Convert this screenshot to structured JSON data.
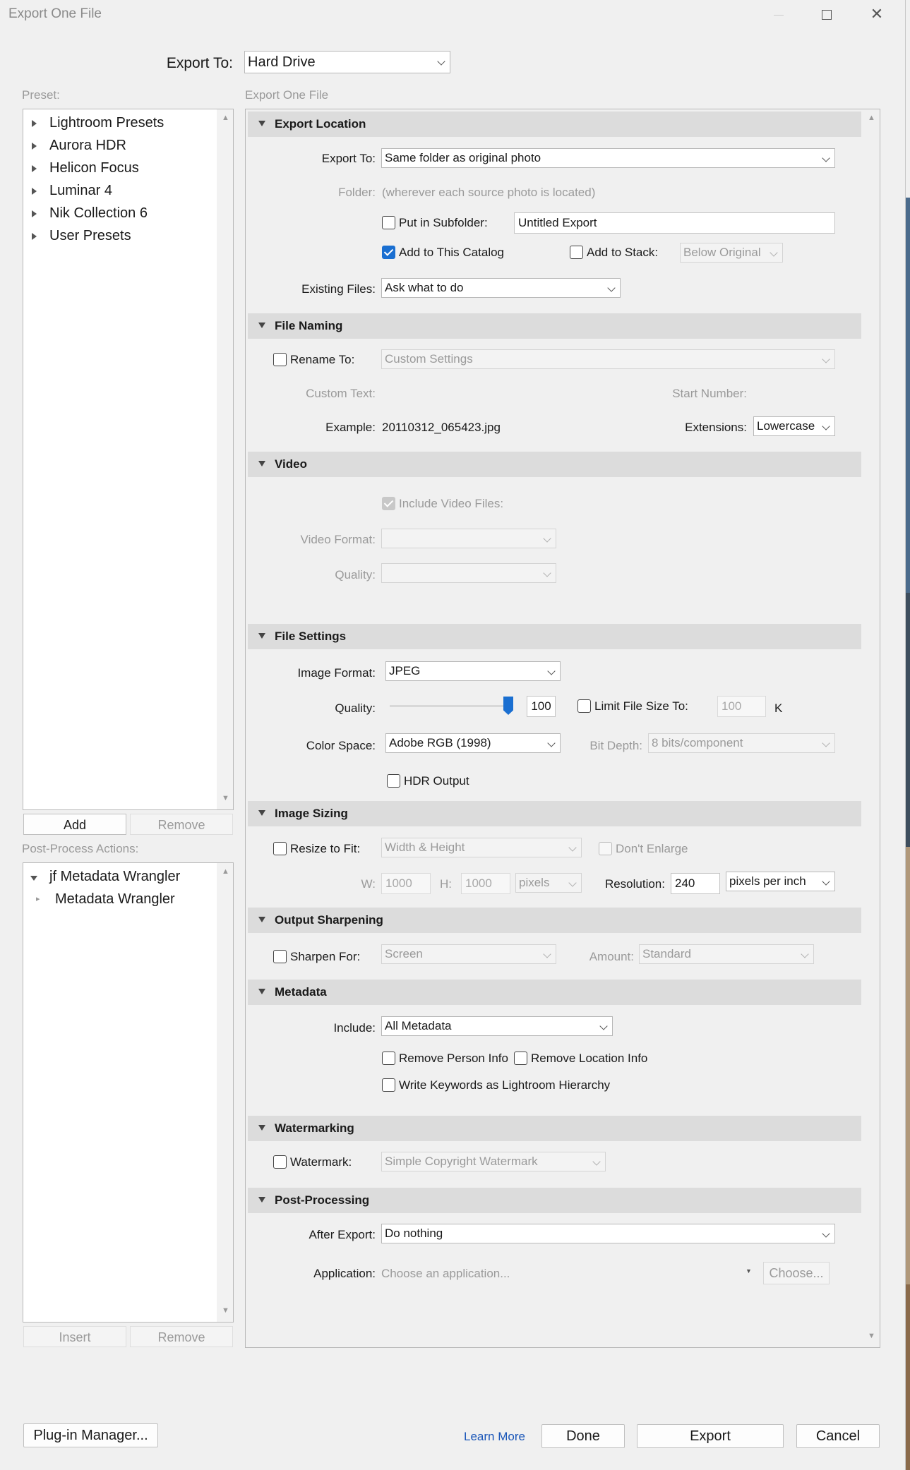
{
  "window": {
    "title": "Export One File"
  },
  "export_to": {
    "label": "Export To:",
    "value": "Hard Drive"
  },
  "preset": {
    "label": "Preset:",
    "items": [
      "Lightroom Presets",
      "Aurora HDR",
      "Helicon Focus",
      "Luminar 4",
      "Nik Collection 6",
      "User Presets"
    ],
    "add": "Add",
    "remove": "Remove"
  },
  "post_process_actions": {
    "label": "Post-Process Actions:",
    "parent": "jf Metadata Wrangler",
    "child": "Metadata Wrangler",
    "insert": "Insert",
    "remove": "Remove"
  },
  "main_label": "Export One File",
  "export_location": {
    "title": "Export Location",
    "export_to_label": "Export To:",
    "export_to_value": "Same folder as original photo",
    "folder_label": "Folder:",
    "folder_value": "(wherever each source photo is located)",
    "subfolder_label": "Put in Subfolder:",
    "subfolder_value": "Untitled Export",
    "add_catalog_label": "Add to This Catalog",
    "add_stack_label": "Add to Stack:",
    "stack_value": "Below Original",
    "existing_label": "Existing Files:",
    "existing_value": "Ask what to do"
  },
  "file_naming": {
    "title": "File Naming",
    "rename_label": "Rename To:",
    "rename_value": "Custom Settings",
    "custom_text_label": "Custom Text:",
    "start_number_label": "Start Number:",
    "example_label": "Example:",
    "example_value": "20110312_065423.jpg",
    "extensions_label": "Extensions:",
    "extensions_value": "Lowercase"
  },
  "video": {
    "title": "Video",
    "include_label": "Include Video Files:",
    "format_label": "Video Format:",
    "quality_label": "Quality:"
  },
  "file_settings": {
    "title": "File Settings",
    "format_label": "Image Format:",
    "format_value": "JPEG",
    "quality_label": "Quality:",
    "quality_value": "100",
    "quality_level": 1.0,
    "limit_label": "Limit File Size To:",
    "limit_value": "100",
    "limit_unit": "K",
    "color_space_label": "Color Space:",
    "color_space_value": "Adobe RGB (1998)",
    "bit_depth_label": "Bit Depth:",
    "bit_depth_value": "8 bits/component",
    "hdr_label": "HDR Output"
  },
  "image_sizing": {
    "title": "Image Sizing",
    "resize_label": "Resize to Fit:",
    "resize_value": "Width & Height",
    "dont_enlarge_label": "Don't Enlarge",
    "w_label": "W:",
    "w_value": "1000",
    "h_label": "H:",
    "h_value": "1000",
    "unit_value": "pixels",
    "resolution_label": "Resolution:",
    "resolution_value": "240",
    "resolution_unit": "pixels per inch"
  },
  "output_sharpening": {
    "title": "Output Sharpening",
    "sharpen_label": "Sharpen For:",
    "sharpen_value": "Screen",
    "amount_label": "Amount:",
    "amount_value": "Standard"
  },
  "metadata": {
    "title": "Metadata",
    "include_label": "Include:",
    "include_value": "All Metadata",
    "remove_person": "Remove Person Info",
    "remove_location": "Remove Location Info",
    "write_keywords": "Write Keywords as Lightroom Hierarchy"
  },
  "watermarking": {
    "title": "Watermarking",
    "watermark_label": "Watermark:",
    "watermark_value": "Simple Copyright Watermark"
  },
  "post_processing": {
    "title": "Post-Processing",
    "after_label": "After Export:",
    "after_value": "Do nothing",
    "app_label": "Application:",
    "app_placeholder": "Choose an application...",
    "choose": "Choose..."
  },
  "footer": {
    "plugin_manager": "Plug-in Manager...",
    "learn_more": "Learn More",
    "done": "Done",
    "export": "Export",
    "cancel": "Cancel"
  },
  "colors": {
    "accent": "#1a6fd1",
    "section_bg": "#dcdcdc",
    "window_bg": "#f0f0f0"
  }
}
